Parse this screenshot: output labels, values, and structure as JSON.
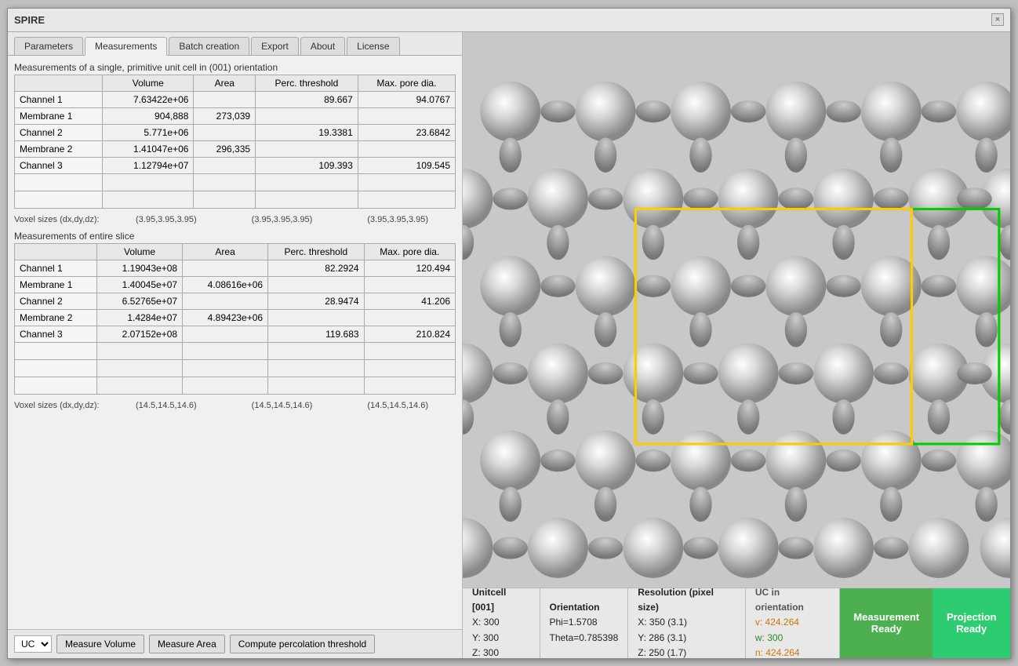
{
  "window": {
    "title": "SPIRE",
    "close_label": "×"
  },
  "tabs": [
    {
      "label": "Parameters",
      "active": false
    },
    {
      "label": "Measurements",
      "active": true
    },
    {
      "label": "Batch creation",
      "active": false
    },
    {
      "label": "Export",
      "active": false
    },
    {
      "label": "About",
      "active": false
    },
    {
      "label": "License",
      "active": false
    }
  ],
  "unit_cell_section": {
    "title": "Measurements of a single, primitive unit cell in (001) orientation",
    "columns": [
      "",
      "Volume",
      "Area",
      "Perc. threshold",
      "Max. pore dia."
    ],
    "rows": [
      {
        "label": "Channel 1",
        "volume": "7.63422e+06",
        "area": "",
        "perc": "89.667",
        "maxpore": "94.0767"
      },
      {
        "label": "Membrane 1",
        "volume": "904,888",
        "area": "273,039",
        "perc": "",
        "maxpore": ""
      },
      {
        "label": "Channel 2",
        "volume": "5.771e+06",
        "area": "",
        "perc": "19.3381",
        "maxpore": "23.6842"
      },
      {
        "label": "Membrane 2",
        "volume": "1.41047e+06",
        "area": "296,335",
        "perc": "",
        "maxpore": ""
      },
      {
        "label": "Channel 3",
        "volume": "1.12794e+07",
        "area": "",
        "perc": "109.393",
        "maxpore": "109.545"
      }
    ]
  },
  "voxel_uc": {
    "label": "Voxel sizes (dx,dy,dz):",
    "v1": "(3.95,3.95,3.95)",
    "v2": "(3.95,3.95,3.95)",
    "v3": "(3.95,3.95,3.95)"
  },
  "slice_section": {
    "title": "Measurements of entire slice",
    "columns": [
      "",
      "Volume",
      "Area",
      "Perc. threshold",
      "Max. pore dia."
    ],
    "rows": [
      {
        "label": "Channel 1",
        "volume": "1.19043e+08",
        "area": "",
        "perc": "82.2924",
        "maxpore": "120.494"
      },
      {
        "label": "Membrane 1",
        "volume": "1.40045e+07",
        "area": "4.08616e+06",
        "perc": "",
        "maxpore": ""
      },
      {
        "label": "Channel 2",
        "volume": "6.52765e+07",
        "area": "",
        "perc": "28.9474",
        "maxpore": "41.206"
      },
      {
        "label": "Membrane 2",
        "volume": "1.4284e+07",
        "area": "4.89423e+06",
        "perc": "",
        "maxpore": ""
      },
      {
        "label": "Channel 3",
        "volume": "2.07152e+08",
        "area": "",
        "perc": "119.683",
        "maxpore": "210.824"
      }
    ]
  },
  "voxel_slice": {
    "label": "Voxel sizes (dx,dy,dz):",
    "v1": "(14.5,14.5,14.6)",
    "v2": "(14.5,14.5,14.6)",
    "v3": "(14.5,14.5,14.6)"
  },
  "controls": {
    "select_value": "UC",
    "btn_volume": "Measure Volume",
    "btn_area": "Measure Area",
    "btn_percolation": "Compute percolation threshold"
  },
  "info_bar": {
    "unitcell": {
      "label": "Unitcell [001]",
      "x": "X: 300",
      "y": "Y: 300",
      "z": "Z: 300"
    },
    "orientation": {
      "label": "Orientation",
      "phi": "Phi=1.5708",
      "theta": "Theta=0.785398"
    },
    "resolution": {
      "label": "Resolution (pixel size)",
      "x": "X:  350 (3.1)",
      "y": "Y:  286 (3.1)",
      "z": "Z:  250 (1.7)"
    },
    "uc_orientation": {
      "label": "UC in orientation",
      "v": "v: 424.264",
      "w": "w: 300",
      "n": "n: 424.264"
    },
    "status_measurement": {
      "line1": "Measurement",
      "line2": "Ready"
    },
    "status_projection": {
      "line1": "Projection",
      "line2": "Ready"
    }
  }
}
